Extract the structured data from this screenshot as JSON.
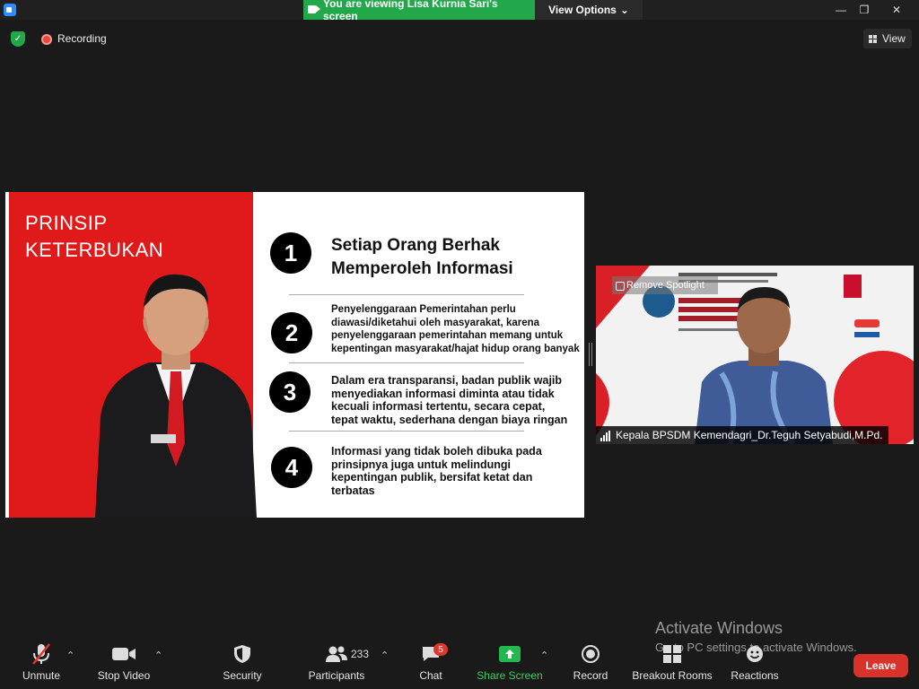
{
  "titlebar": {
    "viewing_banner": "You are viewing Lisa Kurnia Sari's screen",
    "view_options": "View Options",
    "minimize": "—",
    "maximize": "❐",
    "close": "✕"
  },
  "status": {
    "recording": "Recording",
    "view": "View"
  },
  "slide": {
    "title_line1": "PRINSIP",
    "title_line2": "KETERBUKAN",
    "points": [
      {
        "number": "1",
        "lines": [
          "Setiap Orang Berhak",
          "Memperoleh Informasi"
        ]
      },
      {
        "number": "2",
        "lines": [
          "Penyelenggaraan Pemerintahan perlu",
          "diawasi/diketahui oleh masyarakat, karena",
          "penyelenggaraan pemerintahan memang untuk",
          "kepentingan masyarakat/hajat hidup orang banyak"
        ]
      },
      {
        "number": "3",
        "lines": [
          "Dalam era transparansi, badan publik wajib",
          "menyediakan informasi diminta atau tidak",
          "kecuali informasi tertentu, secara cepat,",
          "tepat waktu, sederhana dengan biaya ringan"
        ]
      },
      {
        "number": "4",
        "lines": [
          "Informasi yang tidak boleh dibuka pada",
          "prinsipnya juga untuk melindungi",
          "kepentingan publik, bersifat ketat dan",
          "terbatas"
        ]
      }
    ]
  },
  "video": {
    "remove_spotlight": "Remove Spotlight",
    "participant_name": "Kepala BPSDM Kemendagri_Dr.Teguh Setyabudi,M.Pd."
  },
  "watermark": {
    "title": "Activate Windows",
    "subtitle": "Go to PC settings to activate Windows."
  },
  "toolbar": {
    "unmute": "Unmute",
    "stop_video": "Stop Video",
    "security": "Security",
    "participants": "Participants",
    "participants_count": "233",
    "chat": "Chat",
    "chat_badge": "5",
    "share_screen": "Share Screen",
    "record": "Record",
    "breakout_rooms": "Breakout Rooms",
    "reactions": "Reactions",
    "leave": "Leave"
  },
  "colors": {
    "slide_red": "#e01a1a",
    "share_green": "#22b84d",
    "leave_red": "#d9322b",
    "banner_green": "#22a84a"
  }
}
